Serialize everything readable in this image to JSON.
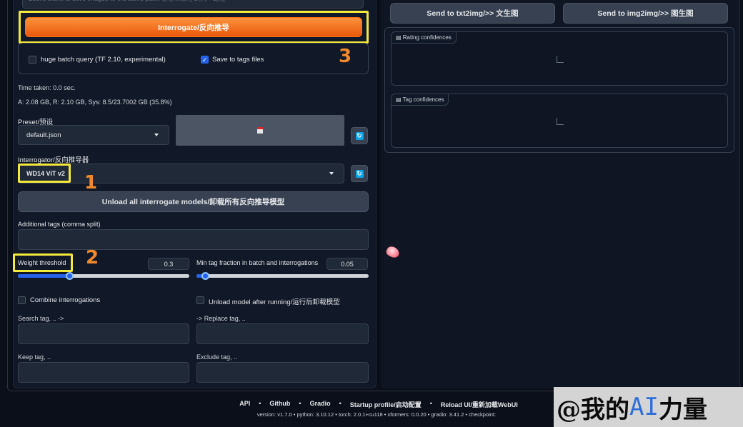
{
  "top_field": {
    "placeholder": "Leave blank to save images to the same path; 留空以保存到同一路径"
  },
  "interrogate": {
    "label": "Interrogate/反向推导",
    "marker": "3"
  },
  "batch": {
    "huge_batch_label": "huge batch query (TF 2.10, experimental)",
    "huge_batch_checked": false,
    "save_tags_label": "Save to tags files",
    "save_tags_checked": true
  },
  "stats": {
    "time_taken": "Time taken: 0.0 sec.",
    "memory": "A: 2.08 GB, R: 2.10 GB, Sys: 8.5/23.7002 GB (35.8%)"
  },
  "preset": {
    "label": "Preset/预设",
    "value": "default.json",
    "save_icon": "floppy-disk-icon"
  },
  "interrogator": {
    "label": "Interrogator/反向推导器",
    "value": "WD14 ViT v2",
    "marker": "1"
  },
  "unload_button": {
    "label": "Unload all interrogate models/卸载所有反向推导模型"
  },
  "additional_tags": {
    "label": "Additional tags (comma split)",
    "value": ""
  },
  "weight_threshold": {
    "label": "Weight threshold",
    "value": "0.3",
    "fraction": 0.3,
    "marker": "2"
  },
  "min_tag_fraction": {
    "label": "Min tag fraction in batch and interrogations",
    "value": "0.05",
    "fraction": 0.05
  },
  "combine": {
    "label": "Combine interrogations",
    "checked": false
  },
  "unload_after": {
    "label": "Unload model after running/运行后卸载模型",
    "checked": false
  },
  "search_tag": {
    "label": "Search tag, .. ->"
  },
  "replace_tag": {
    "label": "-> Replace tag, .."
  },
  "keep_tag": {
    "label": "Keep tag, .."
  },
  "exclude_tag": {
    "label": "Exclude tag, .."
  },
  "right": {
    "send_txt2img": "Send to txt2img/>> 文生图",
    "send_img2img": "Send to img2img/>> 图生图",
    "rating_label": "Rating confidences",
    "tag_label": "Tag confidences"
  },
  "footer": {
    "links": [
      "API",
      "Github",
      "Gradio",
      "Startup profile/启动配置",
      "Reload UI/重新加载WebUI"
    ],
    "versions": "version: v1.7.0  •  python: 3.10.12  •  torch: 2.0.1+cu118  •  xformers: 0.0.20  •  gradio: 3.41.2  •  checkpoint:"
  },
  "watermark": {
    "prefix": "@我的",
    "ai": "AI",
    "suffix": "力量"
  },
  "colors": {
    "accent": "#ea580c",
    "highlight": "#f3e93b",
    "marker": "#f28a2c",
    "slider": "#2563eb"
  }
}
